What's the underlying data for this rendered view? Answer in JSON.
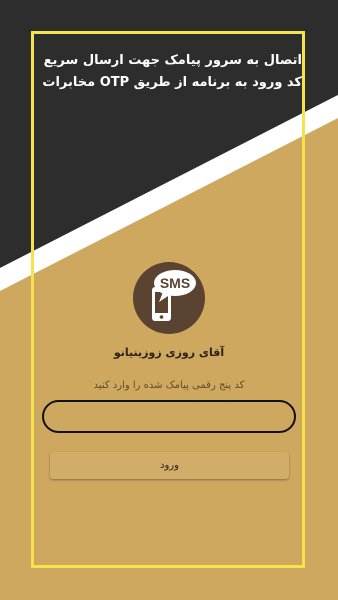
{
  "colors": {
    "background_gold": "#cfa860",
    "dark_band": "#2d2d2d",
    "white_stripe": "#ffffff",
    "frame_yellow": "#f5e34d",
    "logo_brown": "#5a4330"
  },
  "header": {
    "message": "اتصال به سرور پیامک جهت ارسال سریع کد ورود به برنامه از طریق OTP مخابرات"
  },
  "logo": {
    "icon": "sms-phone-icon",
    "text": "SMS"
  },
  "user": {
    "name": "آقای روزی زوزینیانو"
  },
  "form": {
    "instruction": "کد پنج رقمی پیامک شده را وارد کنید",
    "code_value": "",
    "code_placeholder": "",
    "submit_label": "ورود"
  }
}
